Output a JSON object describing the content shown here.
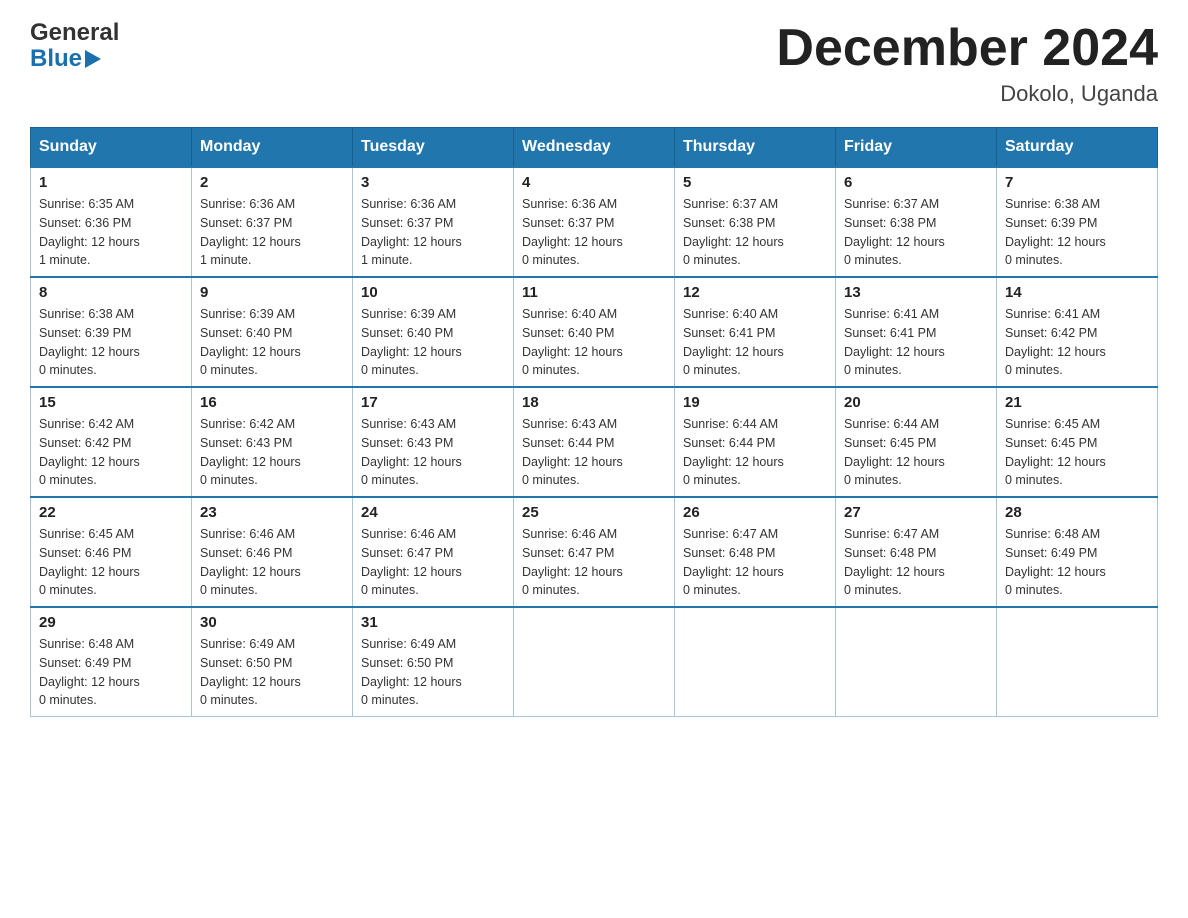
{
  "header": {
    "logo_text_general": "General",
    "logo_text_blue": "Blue",
    "month_title": "December 2024",
    "location": "Dokolo, Uganda"
  },
  "days_of_week": [
    "Sunday",
    "Monday",
    "Tuesday",
    "Wednesday",
    "Thursday",
    "Friday",
    "Saturday"
  ],
  "weeks": [
    [
      {
        "day": "1",
        "sunrise": "6:35 AM",
        "sunset": "6:36 PM",
        "daylight": "12 hours and 1 minute."
      },
      {
        "day": "2",
        "sunrise": "6:36 AM",
        "sunset": "6:37 PM",
        "daylight": "12 hours and 1 minute."
      },
      {
        "day": "3",
        "sunrise": "6:36 AM",
        "sunset": "6:37 PM",
        "daylight": "12 hours and 1 minute."
      },
      {
        "day": "4",
        "sunrise": "6:36 AM",
        "sunset": "6:37 PM",
        "daylight": "12 hours and 0 minutes."
      },
      {
        "day": "5",
        "sunrise": "6:37 AM",
        "sunset": "6:38 PM",
        "daylight": "12 hours and 0 minutes."
      },
      {
        "day": "6",
        "sunrise": "6:37 AM",
        "sunset": "6:38 PM",
        "daylight": "12 hours and 0 minutes."
      },
      {
        "day": "7",
        "sunrise": "6:38 AM",
        "sunset": "6:39 PM",
        "daylight": "12 hours and 0 minutes."
      }
    ],
    [
      {
        "day": "8",
        "sunrise": "6:38 AM",
        "sunset": "6:39 PM",
        "daylight": "12 hours and 0 minutes."
      },
      {
        "day": "9",
        "sunrise": "6:39 AM",
        "sunset": "6:40 PM",
        "daylight": "12 hours and 0 minutes."
      },
      {
        "day": "10",
        "sunrise": "6:39 AM",
        "sunset": "6:40 PM",
        "daylight": "12 hours and 0 minutes."
      },
      {
        "day": "11",
        "sunrise": "6:40 AM",
        "sunset": "6:40 PM",
        "daylight": "12 hours and 0 minutes."
      },
      {
        "day": "12",
        "sunrise": "6:40 AM",
        "sunset": "6:41 PM",
        "daylight": "12 hours and 0 minutes."
      },
      {
        "day": "13",
        "sunrise": "6:41 AM",
        "sunset": "6:41 PM",
        "daylight": "12 hours and 0 minutes."
      },
      {
        "day": "14",
        "sunrise": "6:41 AM",
        "sunset": "6:42 PM",
        "daylight": "12 hours and 0 minutes."
      }
    ],
    [
      {
        "day": "15",
        "sunrise": "6:42 AM",
        "sunset": "6:42 PM",
        "daylight": "12 hours and 0 minutes."
      },
      {
        "day": "16",
        "sunrise": "6:42 AM",
        "sunset": "6:43 PM",
        "daylight": "12 hours and 0 minutes."
      },
      {
        "day": "17",
        "sunrise": "6:43 AM",
        "sunset": "6:43 PM",
        "daylight": "12 hours and 0 minutes."
      },
      {
        "day": "18",
        "sunrise": "6:43 AM",
        "sunset": "6:44 PM",
        "daylight": "12 hours and 0 minutes."
      },
      {
        "day": "19",
        "sunrise": "6:44 AM",
        "sunset": "6:44 PM",
        "daylight": "12 hours and 0 minutes."
      },
      {
        "day": "20",
        "sunrise": "6:44 AM",
        "sunset": "6:45 PM",
        "daylight": "12 hours and 0 minutes."
      },
      {
        "day": "21",
        "sunrise": "6:45 AM",
        "sunset": "6:45 PM",
        "daylight": "12 hours and 0 minutes."
      }
    ],
    [
      {
        "day": "22",
        "sunrise": "6:45 AM",
        "sunset": "6:46 PM",
        "daylight": "12 hours and 0 minutes."
      },
      {
        "day": "23",
        "sunrise": "6:46 AM",
        "sunset": "6:46 PM",
        "daylight": "12 hours and 0 minutes."
      },
      {
        "day": "24",
        "sunrise": "6:46 AM",
        "sunset": "6:47 PM",
        "daylight": "12 hours and 0 minutes."
      },
      {
        "day": "25",
        "sunrise": "6:46 AM",
        "sunset": "6:47 PM",
        "daylight": "12 hours and 0 minutes."
      },
      {
        "day": "26",
        "sunrise": "6:47 AM",
        "sunset": "6:48 PM",
        "daylight": "12 hours and 0 minutes."
      },
      {
        "day": "27",
        "sunrise": "6:47 AM",
        "sunset": "6:48 PM",
        "daylight": "12 hours and 0 minutes."
      },
      {
        "day": "28",
        "sunrise": "6:48 AM",
        "sunset": "6:49 PM",
        "daylight": "12 hours and 0 minutes."
      }
    ],
    [
      {
        "day": "29",
        "sunrise": "6:48 AM",
        "sunset": "6:49 PM",
        "daylight": "12 hours and 0 minutes."
      },
      {
        "day": "30",
        "sunrise": "6:49 AM",
        "sunset": "6:50 PM",
        "daylight": "12 hours and 0 minutes."
      },
      {
        "day": "31",
        "sunrise": "6:49 AM",
        "sunset": "6:50 PM",
        "daylight": "12 hours and 0 minutes."
      },
      null,
      null,
      null,
      null
    ]
  ],
  "labels": {
    "sunrise": "Sunrise:",
    "sunset": "Sunset:",
    "daylight": "Daylight:"
  }
}
